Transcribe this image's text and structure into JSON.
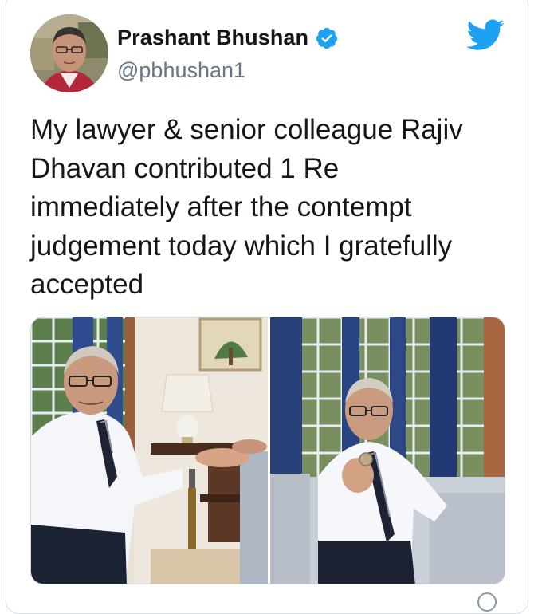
{
  "tweet": {
    "author_name": "Prashant Bhushan",
    "author_handle": "@pbhushan1",
    "verified": true,
    "text": "My lawyer & senior colleague Rajiv\nDhavan contributed 1 Re\nimmediately after the contempt\njudgement today which I gratefully\naccepted",
    "photos": [
      {
        "name": "photo-left",
        "description": "coin handed over across side table"
      },
      {
        "name": "photo-right",
        "description": "man seated on sofa holding coin"
      }
    ]
  },
  "icons": {
    "verified": "verified-badge-icon",
    "brand": "twitter-bird-icon",
    "corner": "more-icon"
  },
  "colors": {
    "twitter_blue": "#1da1f2",
    "text_primary": "#14171a",
    "text_secondary": "#657786",
    "card_border": "#d7dde2"
  }
}
